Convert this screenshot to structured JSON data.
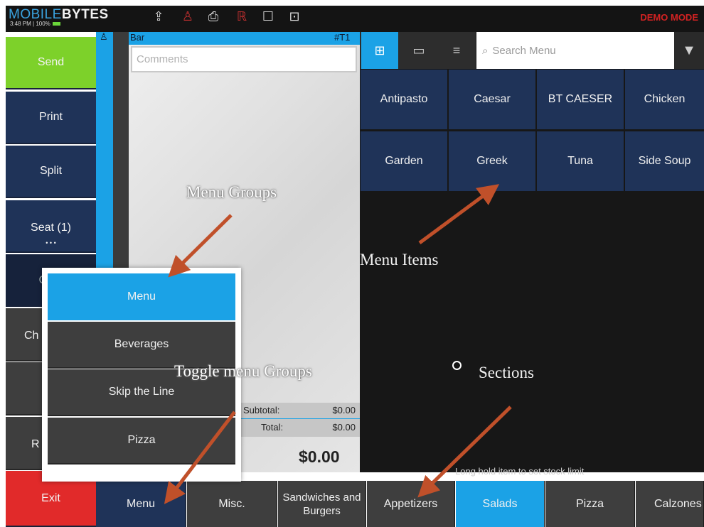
{
  "topbar": {
    "logo_part1": "MOBILE",
    "logo_part2": "BYTES",
    "status": "3:48 PM | 100%",
    "demo_mode": "DEMO MODE"
  },
  "left_buttons": {
    "send": "Send",
    "print": "Print",
    "split": "Split",
    "seat": "Seat (1)",
    "seat_dots": "• • •",
    "stub_c": "C",
    "stub_ch": "Ch",
    "stub_r": "R",
    "exit": "Exit"
  },
  "order": {
    "location": "Bar",
    "table": "#T1",
    "comments_placeholder": "Comments",
    "subtotal_label": "Subtotal:",
    "subtotal_value": "$0.00",
    "total_label": "Total:",
    "total_value": "$0.00",
    "grand_total": "$0.00"
  },
  "search": {
    "placeholder": "Search Menu"
  },
  "menu_items": [
    [
      "Antipasto",
      "Caesar",
      "BT CAESER",
      "Chicken"
    ],
    [
      "Garden",
      "Greek",
      "Tuna",
      "Side Soup"
    ]
  ],
  "hint": "Long hold item to set stock limit",
  "sections": {
    "menu": "Menu",
    "misc": "Misc.",
    "sandwiches": "Sandwiches and Burgers",
    "appetizers": "Appetizers",
    "salads": "Salads",
    "pizza": "Pizza",
    "calzones": "Calzones"
  },
  "menu_groups_popup": [
    "Menu",
    "Beverages",
    "Skip the Line",
    "Pizza"
  ],
  "annotations": {
    "menu_groups": "Menu Groups",
    "menu_items": "Menu Items",
    "toggle_menu_groups": "Toggle menu Groups",
    "sections": "Sections"
  },
  "colors": {
    "accent_blue": "#1ba2e6",
    "navy": "#1f3358",
    "send_green": "#7dd12a",
    "exit_red": "#e12a2a",
    "arrow": "#c0502a"
  }
}
